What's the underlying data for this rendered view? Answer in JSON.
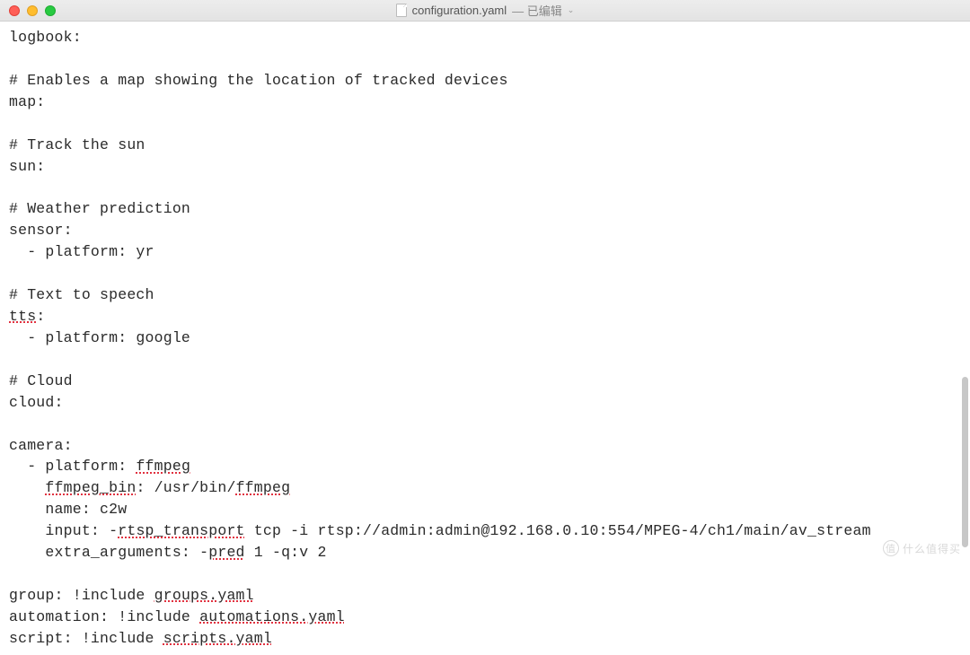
{
  "titlebar": {
    "filename": "configuration.yaml",
    "edited_label": "— 已编辑"
  },
  "yaml": {
    "logbook_key": "logbook:",
    "comment_map": "# Enables a map showing the location of tracked devices",
    "map_key": "map:",
    "comment_sun": "# Track the sun",
    "sun_key": "sun:",
    "comment_weather": "# Weather prediction",
    "sensor_key": "sensor:",
    "sensor_platform": "  - platform: yr",
    "comment_tts": "# Text to speech",
    "tts_key": "tts",
    "tts_platform": "  - platform: google",
    "comment_cloud": "# Cloud",
    "cloud_key": "cloud:",
    "camera_key": "camera:",
    "camera_platform_prefix": "  - platform: ",
    "camera_platform_val": "ffmpeg",
    "ffmpeg_bin_key": "ffmpeg_bin",
    "ffmpeg_bin_val_prefix": ": /usr/bin/",
    "ffmpeg_bin_val": "ffmpeg",
    "camera_name": "    name: c2w",
    "input_prefix": "    input: -",
    "input_rtsp": "rtsp_transport",
    "input_tcp": " tcp -i rtsp://admin:admin@192.168.0.10:554/MPEG-4/ch1/main/av_stream",
    "extra_args_prefix": "    extra_arguments: -",
    "extra_args_pred": "pred",
    "extra_args_suffix": " 1 -q:v 2",
    "group_prefix": "group: !include ",
    "group_file": "groups.yaml",
    "automation_prefix": "automation: !include ",
    "automation_file": "automations.yaml",
    "script_prefix": "script: !include ",
    "script_file": "scripts.yaml"
  },
  "watermark": {
    "text": "什么值得买"
  }
}
